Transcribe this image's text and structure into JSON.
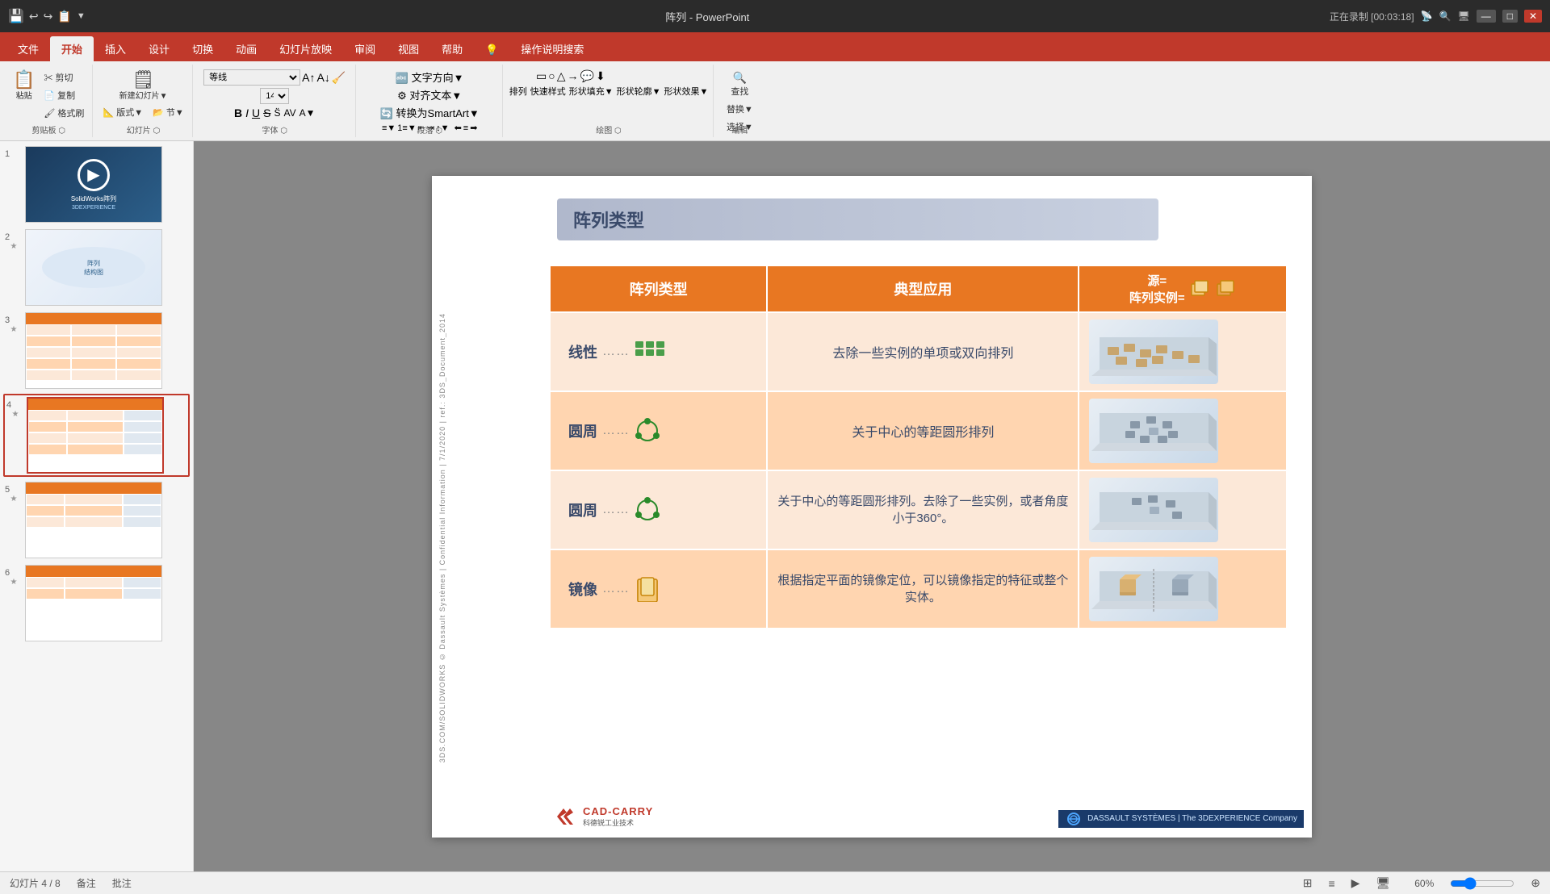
{
  "titlebar": {
    "left_icons": [
      "💾",
      "↩",
      "↪",
      "📋",
      "▼"
    ],
    "title": "阵列 - PowerPoint",
    "right_text": "正在录制 [00:03:18]",
    "right_icons": [
      "📡",
      "🔍",
      "🖥",
      "✕"
    ]
  },
  "ribbon": {
    "tabs": [
      {
        "label": "文件",
        "active": false
      },
      {
        "label": "开始",
        "active": true
      },
      {
        "label": "插入",
        "active": false
      },
      {
        "label": "设计",
        "active": false
      },
      {
        "label": "切换",
        "active": false
      },
      {
        "label": "动画",
        "active": false
      },
      {
        "label": "幻灯片放映",
        "active": false
      },
      {
        "label": "审阅",
        "active": false
      },
      {
        "label": "视图",
        "active": false
      },
      {
        "label": "帮助",
        "active": false
      },
      {
        "label": "💡",
        "active": false
      },
      {
        "label": "操作说明搜索",
        "active": false
      }
    ],
    "groups": [
      {
        "name": "剪贴板",
        "items": [
          "粘贴",
          "剪切",
          "复制",
          "格式刷"
        ]
      },
      {
        "name": "幻灯片",
        "items": [
          "新建幻灯片",
          "版式▼",
          "节▼"
        ]
      },
      {
        "name": "字体",
        "items": []
      },
      {
        "name": "段落",
        "items": []
      },
      {
        "name": "绘图",
        "items": []
      },
      {
        "name": "编辑",
        "items": [
          "查找",
          "替换▼",
          "选择▼"
        ]
      }
    ]
  },
  "slides": [
    {
      "num": "1",
      "star": false,
      "type": "intro"
    },
    {
      "num": "2",
      "star": true,
      "type": "diagram"
    },
    {
      "num": "3",
      "star": true,
      "type": "table-orange"
    },
    {
      "num": "4",
      "star": true,
      "type": "table-orange",
      "active": true
    },
    {
      "num": "5",
      "star": true,
      "type": "table-orange2"
    },
    {
      "num": "6",
      "star": true,
      "type": "table-orange3"
    }
  ],
  "slide": {
    "title": "阵列类型",
    "sidebar_text": "3DS.COM/SOLIDWORKS © Dassault Systèmes | Confidential Information | 7/1/2020 | ref.: 3DS_Document_2014",
    "table": {
      "headers": [
        "阵列类型",
        "典型应用",
        "源=\n阵列实例="
      ],
      "rows": [
        {
          "type_label": "线性",
          "type_dots": "……",
          "type_icon": "🟩🟩🟩",
          "app_text": "去除一些实例的单项或双向排列",
          "has_image": true,
          "img_alt": "linear-array-3d-image"
        },
        {
          "type_label": "圆周",
          "type_dots": "……",
          "type_icon": "🟢",
          "app_text": "关于中心的等距圆形排列",
          "has_image": true,
          "img_alt": "circular-array-3d-image"
        },
        {
          "type_label": "圆周",
          "type_dots": "……",
          "type_icon": "🟢",
          "app_text": "关于中心的等距圆形排列。去除了一些实例，或者角度小于360°。",
          "has_image": true,
          "img_alt": "circular-partial-array-3d-image"
        },
        {
          "type_label": "镜像",
          "type_dots": "……",
          "type_icon": "📋",
          "app_text": "根据指定平面的镜像定位，可以镜像指定的特征或整个实体。",
          "has_image": true,
          "img_alt": "mirror-array-3d-image"
        }
      ]
    },
    "logo_left": {
      "brand1": "CAD-CARRY",
      "brand2": "科德锐工业技术"
    },
    "logo_right": "DASSAULT SYSTÈMES | The 3DEXPERIENCE Company"
  },
  "statusbar": {
    "slide_info": "幻灯片 4 / 8",
    "notes": "备注",
    "comments": "批注",
    "zoom": "60%"
  }
}
